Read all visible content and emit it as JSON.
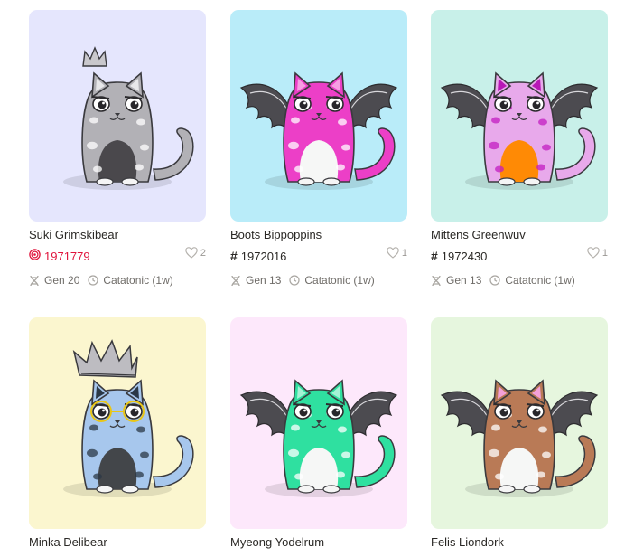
{
  "kitties": [
    {
      "name": "Suki Grimskibear",
      "id": "1971779",
      "id_special": true,
      "likes": "2",
      "generation": "Gen 20",
      "cooldown": "Catatonic (1w)",
      "bg_color": "#e5e6fd",
      "body_color": "#b2b1b6",
      "accent_color": "#e8e8ea",
      "belly_color": "#4a484c",
      "wings": false,
      "crown": "small",
      "glasses": false,
      "spots_color": "#ffffff"
    },
    {
      "name": "Boots Bippoppins",
      "id": "1972016",
      "id_special": false,
      "likes": "1",
      "generation": "Gen 13",
      "cooldown": "Catatonic (1w)",
      "bg_color": "#b9ecf9",
      "body_color": "#ec3fc7",
      "accent_color": "#f79ee3",
      "belly_color": "#f6f7f6",
      "wings": true,
      "crown": "none",
      "glasses": false,
      "spots_color": "#ffffff"
    },
    {
      "name": "Mittens Greenwuv",
      "id": "1972430",
      "id_special": false,
      "likes": "1",
      "generation": "Gen 13",
      "cooldown": "Catatonic (1w)",
      "bg_color": "#c8f0e9",
      "body_color": "#e8a9eb",
      "accent_color": "#b818b6",
      "belly_color": "#ff8a05",
      "wings": true,
      "crown": "none",
      "glasses": false,
      "spots_color": "#c31ec1"
    },
    {
      "name": "Minka Delibear",
      "id": "",
      "id_special": false,
      "likes": "",
      "generation": "",
      "cooldown": "",
      "bg_color": "#fbf6cf",
      "body_color": "#a7c7ed",
      "accent_color": "#2b3846",
      "belly_color": "#43464a",
      "wings": false,
      "crown": "big",
      "glasses": true,
      "spots_color": "#2b3846"
    },
    {
      "name": "Myeong Yodelrum",
      "id": "",
      "id_special": false,
      "likes": "",
      "generation": "",
      "cooldown": "",
      "bg_color": "#fde8fb",
      "body_color": "#2fe0a0",
      "accent_color": "#a4f3d5",
      "belly_color": "#f6f7f6",
      "wings": true,
      "crown": "none",
      "glasses": false,
      "spots_color": "#ffffff"
    },
    {
      "name": "Felis Liondork",
      "id": "",
      "id_special": false,
      "likes": "",
      "generation": "",
      "cooldown": "",
      "bg_color": "#e6f6de",
      "body_color": "#b97a56",
      "accent_color": "#f3a0d8",
      "belly_color": "#f6f7f6",
      "wings": true,
      "crown": "none",
      "glasses": false,
      "spots_color": "#ffffff"
    }
  ]
}
